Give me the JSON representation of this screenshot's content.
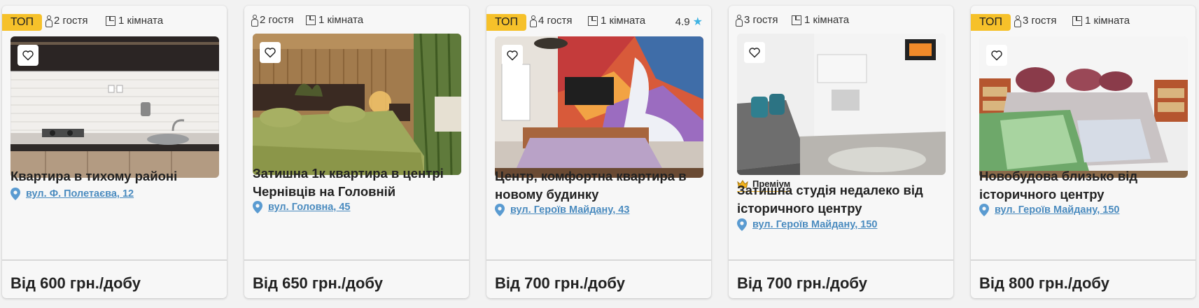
{
  "cards": [
    {
      "badge": "ТОП",
      "guests": "2 гостя",
      "rooms": "1 кімната",
      "rating": "",
      "title": "Квартира в тихому районі",
      "address": "вул. Ф. Полетаєва, 12",
      "price": "Від 600 грн./добу",
      "premium": ""
    },
    {
      "badge": "",
      "guests": "2 гостя",
      "rooms": "1 кімната",
      "rating": "",
      "title": "Затишна 1к квартира в центрі Чернівців на Головній",
      "address": "вул. Головна, 45",
      "price": "Від 650 грн./добу",
      "premium": ""
    },
    {
      "badge": "ТОП",
      "guests": "4 гостя",
      "rooms": "1 кімната",
      "rating": "4.9",
      "title": "Центр, комфортна квартира в новому будинку",
      "address": "вул. Героїв Майдану, 43",
      "price": "Від 700 грн./добу",
      "premium": ""
    },
    {
      "badge": "",
      "guests": "3 гостя",
      "rooms": "1 кімната",
      "rating": "",
      "title": "Затишна студія недалеко від історичного центру",
      "address": "вул. Героїв Майдану, 150",
      "price": "Від 700 грн./добу",
      "premium": "Преміум"
    },
    {
      "badge": "ТОП",
      "guests": "3 гостя",
      "rooms": "1 кімната",
      "rating": "",
      "title": "Новобудова близько від історичного центру",
      "address": "вул. Героїв Майдану, 150",
      "price": "Від 800 грн./добу",
      "premium": ""
    }
  ],
  "colors": {
    "badge": "#f6c12a",
    "link": "#4a8bbf",
    "star": "#3fb3e3",
    "premium_line": "#f3b31d"
  }
}
